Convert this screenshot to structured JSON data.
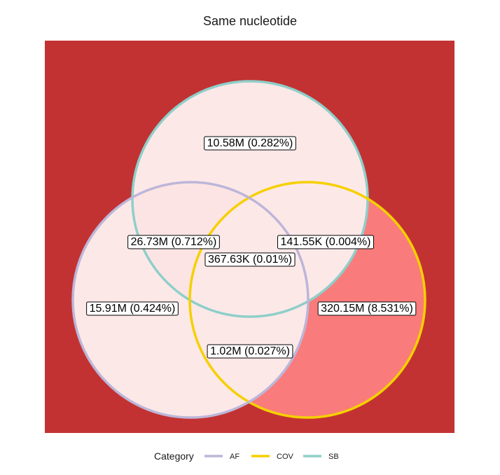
{
  "chart_data": {
    "type": "venn",
    "title": "Same nucleotide",
    "sets": [
      {
        "name": "AF",
        "color": "#bcb6d8"
      },
      {
        "name": "COV",
        "color": "#f5d000"
      },
      {
        "name": "SB",
        "color": "#8ecfc9"
      }
    ],
    "regions": [
      {
        "sets": [
          "SB"
        ],
        "label": "10.58M (0.282%)",
        "fill": "#fde8e8"
      },
      {
        "sets": [
          "AF",
          "SB"
        ],
        "label": "26.73M (0.712%)",
        "fill": "#fde4e4"
      },
      {
        "sets": [
          "COV",
          "SB"
        ],
        "label": "141.55K (0.004%)",
        "fill": "#fde8e8"
      },
      {
        "sets": [
          "AF",
          "COV",
          "SB"
        ],
        "label": "367.63K (0.01%)",
        "fill": "#fde8e8"
      },
      {
        "sets": [
          "AF"
        ],
        "label": "15.91M (0.424%)",
        "fill": "#fde8e8"
      },
      {
        "sets": [
          "COV"
        ],
        "label": "320.15M (8.531%)",
        "fill": "#fa7b7b"
      },
      {
        "sets": [
          "AF",
          "COV"
        ],
        "label": "1.02M (0.027%)",
        "fill": "#fde8e8"
      }
    ],
    "background_color": "#c33232",
    "legend": {
      "title": "Category",
      "position": "bottom"
    }
  }
}
